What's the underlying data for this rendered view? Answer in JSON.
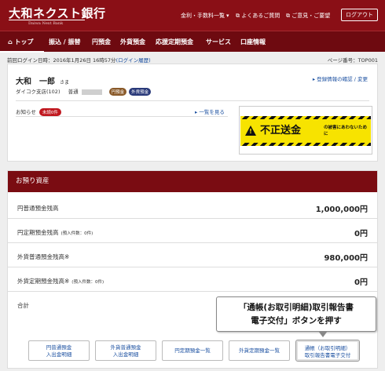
{
  "header": {
    "logo": "大和ネクスト銀行",
    "logo_sub": "Daiwa Next Bank",
    "links": [
      "金利・手数料一覧",
      "よくあるご質問",
      "ご意見・ご要望"
    ],
    "logout_label": "ログアウト"
  },
  "nav": {
    "items": [
      "トップ",
      "振込 / 振替",
      "円預金",
      "外貨預金",
      "応援定期預金",
      "サービス",
      "口座情報"
    ]
  },
  "meta": {
    "last_login_prefix": "前回ログイン日時：2016年1月26日 16時57分",
    "last_login_link": "(ログイン履歴)",
    "page_no": "ページ番号：TOP001"
  },
  "user": {
    "name": "大和　一郎",
    "honorific": "さま",
    "branch": "ダイコク支店(102)",
    "account_type": "普通",
    "badge_yen": "円預金",
    "badge_fx": "外貨預金",
    "profile_link": "登録情報の確認 / 変更"
  },
  "notice": {
    "label": "お知らせ",
    "unread": "未読0件",
    "list_link": "一覧を見る"
  },
  "banner": {
    "main": "不正送金",
    "sub": "の被害にあわないために"
  },
  "assets": {
    "title": "お預り資産",
    "rows": [
      {
        "label": "円普通預金残高",
        "note": "",
        "value": "1,000,000円"
      },
      {
        "label": "円定期預金残高",
        "note": "(預入件数：0件)",
        "value": "0円"
      },
      {
        "label": "外貨普通預金残高※",
        "note": "",
        "value": "980,000円"
      },
      {
        "label": "外貨定期預金残高※",
        "note": "(預入件数：0件)",
        "value": "0円"
      },
      {
        "label": "合計",
        "note": "",
        "value": ""
      }
    ]
  },
  "callout": {
    "line1": "「通帳(お取引明細)取引報告書",
    "line2": "電子交付」ボタンを押す"
  },
  "buttons": [
    {
      "line1": "円普通預金",
      "line2": "入出金明細"
    },
    {
      "line1": "外貨普通預金",
      "line2": "入出金明細"
    },
    {
      "line1": "円定期預金一覧",
      "line2": ""
    },
    {
      "line1": "外貨定期預金一覧",
      "line2": ""
    },
    {
      "line1": "通帳（お取引明細）",
      "line2": "取引報告書電子交付"
    }
  ],
  "colors": {
    "brand": "#8a0f16",
    "nav": "#6e0a10",
    "link": "#1a4fa0",
    "banner_yellow": "#f7e300"
  }
}
